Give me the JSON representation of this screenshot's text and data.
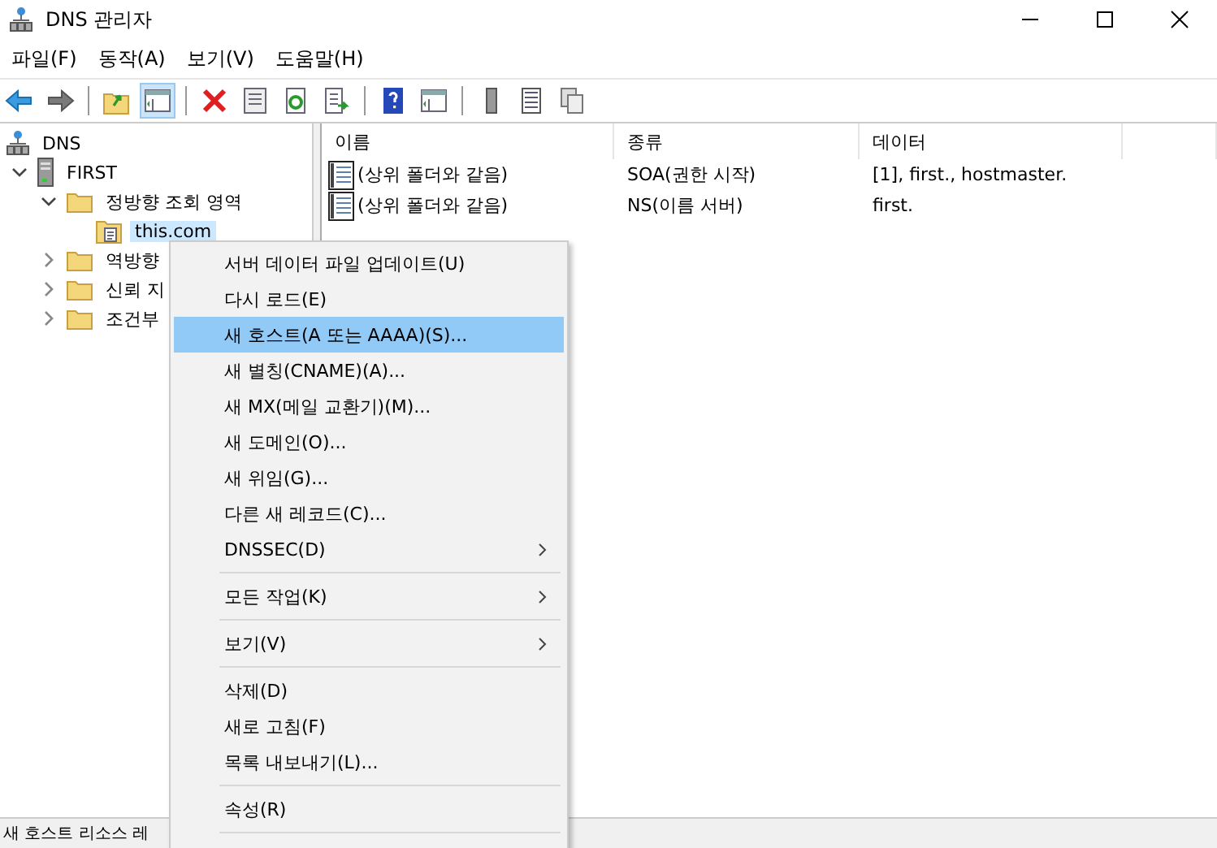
{
  "window": {
    "title": "DNS 관리자"
  },
  "menu_bar": [
    "파일(F)",
    "동작(A)",
    "보기(V)",
    "도움말(H)"
  ],
  "tree": [
    {
      "label": "DNS",
      "kind": "root",
      "selected": false,
      "children": [
        {
          "label": "FIRST",
          "kind": "server",
          "expanded": true,
          "selected": false,
          "children": [
            {
              "label": "정방향 조회 영역",
              "kind": "folder",
              "expanded": true,
              "selected": false,
              "children": [
                {
                  "label": "this.com",
                  "kind": "zone",
                  "selected": true
                }
              ]
            },
            {
              "label": "역방향",
              "kind": "folder",
              "expanded": false,
              "selected": false
            },
            {
              "label": "신뢰 지",
              "kind": "folder",
              "expanded": false,
              "selected": false
            },
            {
              "label": "조건부",
              "kind": "folder",
              "expanded": false,
              "selected": false
            }
          ]
        }
      ]
    }
  ],
  "table": {
    "columns": [
      "이름",
      "종류",
      "데이터"
    ],
    "rows": [
      {
        "name": "(상위 폴더와 같음)",
        "type": "SOA(권한 시작)",
        "data": "[1], first., hostmaster."
      },
      {
        "name": "(상위 폴더와 같음)",
        "type": "NS(이름 서버)",
        "data": "first."
      }
    ]
  },
  "context_menu": [
    {
      "kind": "item",
      "label": "서버 데이터 파일 업데이트(U)",
      "selected": false,
      "submenu": false
    },
    {
      "kind": "item",
      "label": "다시 로드(E)",
      "selected": false,
      "submenu": false
    },
    {
      "kind": "item",
      "label": "새 호스트(A 또는 AAAA)(S)...",
      "selected": true,
      "submenu": false
    },
    {
      "kind": "item",
      "label": "새 별칭(CNAME)(A)...",
      "selected": false,
      "submenu": false
    },
    {
      "kind": "item",
      "label": "새 MX(메일 교환기)(M)...",
      "selected": false,
      "submenu": false
    },
    {
      "kind": "item",
      "label": "새 도메인(O)...",
      "selected": false,
      "submenu": false
    },
    {
      "kind": "item",
      "label": "새 위임(G)...",
      "selected": false,
      "submenu": false
    },
    {
      "kind": "item",
      "label": "다른 새 레코드(C)...",
      "selected": false,
      "submenu": false
    },
    {
      "kind": "item",
      "label": "DNSSEC(D)",
      "selected": false,
      "submenu": true
    },
    {
      "kind": "separator"
    },
    {
      "kind": "item",
      "label": "모든 작업(K)",
      "selected": false,
      "submenu": true
    },
    {
      "kind": "separator"
    },
    {
      "kind": "item",
      "label": "보기(V)",
      "selected": false,
      "submenu": true
    },
    {
      "kind": "separator"
    },
    {
      "kind": "item",
      "label": "삭제(D)",
      "selected": false,
      "submenu": false
    },
    {
      "kind": "item",
      "label": "새로 고침(F)",
      "selected": false,
      "submenu": false
    },
    {
      "kind": "item",
      "label": "목록 내보내기(L)...",
      "selected": false,
      "submenu": false
    },
    {
      "kind": "separator"
    },
    {
      "kind": "item",
      "label": "속성(R)",
      "selected": false,
      "submenu": false
    },
    {
      "kind": "separator"
    }
  ],
  "status_bar": "새 호스트 리소스 레"
}
